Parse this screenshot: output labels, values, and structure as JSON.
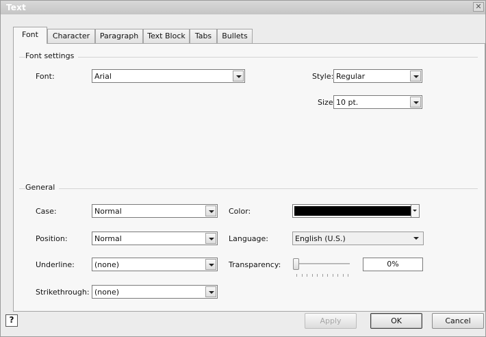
{
  "window": {
    "title": "Text",
    "close_label": "✕"
  },
  "tabs": [
    {
      "label": "Font",
      "active": true
    },
    {
      "label": "Character",
      "active": false
    },
    {
      "label": "Paragraph",
      "active": false
    },
    {
      "label": "Text Block",
      "active": false
    },
    {
      "label": "Tabs",
      "active": false
    },
    {
      "label": "Bullets",
      "active": false
    }
  ],
  "font_settings": {
    "group_label": "Font settings",
    "font_label": "Font:",
    "font_value": "Arial",
    "style_label": "Style:",
    "style_value": "Regular",
    "size_label": "Size:",
    "size_value": "10 pt."
  },
  "general": {
    "group_label": "General",
    "case_label": "Case:",
    "case_value": "Normal",
    "position_label": "Position:",
    "position_value": "Normal",
    "underline_label": "Underline:",
    "underline_value": "(none)",
    "strikethrough_label": "Strikethrough:",
    "strikethrough_value": "(none)",
    "color_label": "Color:",
    "color_value": "#000000",
    "language_label": "Language:",
    "language_value": "English (U.S.)",
    "transparency_label": "Transparency:",
    "transparency_value": "0%",
    "transparency_level": 0
  },
  "footer": {
    "help_icon": "?",
    "apply_label": "Apply",
    "ok_label": "OK",
    "cancel_label": "Cancel"
  }
}
